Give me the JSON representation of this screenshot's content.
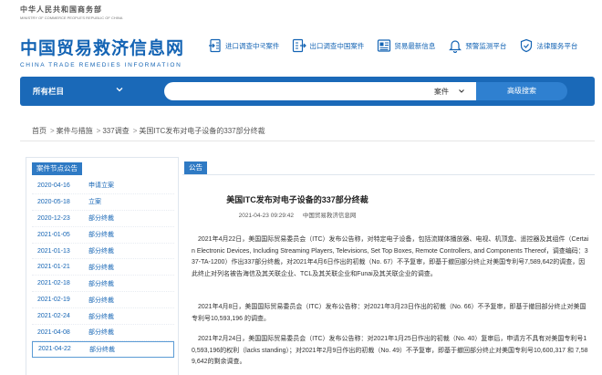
{
  "ministry": {
    "cn": "中华人民共和国商务部",
    "en": "MINISTRY OF COMMERCE PEOPLE'S REPUBLIC OF CHINA"
  },
  "brand": {
    "cn": "中国贸易救济信息网",
    "en": "CHINA TRADE REMEDIES INFORMATION"
  },
  "topnav": [
    {
      "label": "进口调查中국案件",
      "icon": "import-doc-icon"
    },
    {
      "label": "出口调查中国案件",
      "icon": "export-doc-icon"
    },
    {
      "label": "贸易最新信息",
      "icon": "news-icon"
    },
    {
      "label": "预警监测平台",
      "icon": "bell-icon"
    },
    {
      "label": "法律服务平台",
      "icon": "shield-icon"
    }
  ],
  "search": {
    "all_columns": "所有栏目",
    "category": "案件",
    "button": "高级搜索",
    "placeholder": ""
  },
  "breadcrumb": [
    "首页",
    "案件与措施",
    "337调查",
    "美国ITC发布对电子设备的337部分终裁"
  ],
  "left": {
    "header": "案件节点公告",
    "rows": [
      {
        "date": "2020-04-16",
        "label": "申请立案"
      },
      {
        "date": "2020-05-18",
        "label": "立案"
      },
      {
        "date": "2020-12-23",
        "label": "部分终裁"
      },
      {
        "date": "2021-01-05",
        "label": "部分终裁"
      },
      {
        "date": "2021-01-13",
        "label": "部分终裁"
      },
      {
        "date": "2021-01-21",
        "label": "部分终裁"
      },
      {
        "date": "2021-02-18",
        "label": "部分终裁"
      },
      {
        "date": "2021-02-19",
        "label": "部分终裁"
      },
      {
        "date": "2021-02-24",
        "label": "部分终裁"
      },
      {
        "date": "2021-04-08",
        "label": "部分终裁"
      },
      {
        "date": "2021-04-22",
        "label": "部分终裁"
      }
    ]
  },
  "right": {
    "tab": "公告",
    "title": "美国ITC发布对电子设备的337部分终裁",
    "date": "2021-04-23 09:29:42",
    "source": "中国贸易救济信息网",
    "paragraphs": [
      "2021年4月22日，美国国际贸易委员会（ITC）发布公告称，对特定电子设备，包括流媒体播放器、电视、机顶盒、遥控器及其组件（Certain Electronic Devices, Including Streaming Players, Televisions, Set Top Boxes, Remote Controllers, and Components Thereof，调查编码：337-TA-1200）作出337部分终裁，对2021年4月6日作出的初裁（No. 67）不予复审，即基于撤回部分终止对美国专利号7,589,642的调查，因此终止对列名被告海信及其关联企业、TCL及其关联企业和Funai及其关联企业的调查。",
      "2021年4月8日，美国国际贸易委员会（ITC）发布公告称：对2021年3月23日作出的初裁（No. 66）不予复审，即基于撤回部分终止对美国专利号10,593,196 的调查。",
      "2021年2月24日，美国国际贸易委员会（ITC）发布公告称：对2021年1月25日作出的初裁（No. 40）复审后，申请方不具有对美国专利号10,593,196的权利（lacks standing）；对2021年2月9日作出的初裁（No. 49）不予复审，即基于撤回部分终止对美国专利号10,600,317 和 7,589,642的剩余调查。"
    ]
  },
  "colors": {
    "brand": "#1464b4",
    "bar": "#1a69b8",
    "button": "#2f80d0"
  }
}
